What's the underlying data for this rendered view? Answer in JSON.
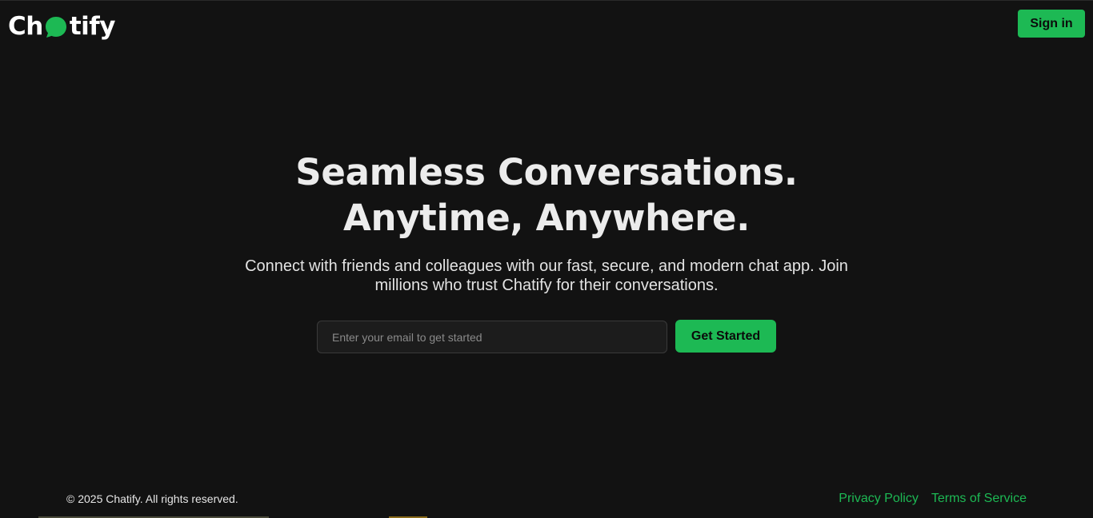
{
  "header": {
    "logo": {
      "prefix": "Ch",
      "suffix": "tify",
      "bubble_icon": "chat-bubble-icon",
      "bubble_color": "#1db954"
    },
    "signin_label": "Sign in"
  },
  "hero": {
    "title_line1": "Seamless Conversations.",
    "title_line2": "Anytime, Anywhere.",
    "subtitle": "Connect with friends and colleagues with our fast, secure, and modern chat app. Join millions who trust Chatify for their conversations.",
    "email_placeholder": "Enter your email to get started",
    "email_value": "",
    "cta_label": "Get Started"
  },
  "footer": {
    "copyright": "© 2025 Chatify. All rights reserved.",
    "links": [
      {
        "label": "Privacy Policy"
      },
      {
        "label": "Terms of Service"
      }
    ]
  },
  "colors": {
    "background": "#121212",
    "accent": "#1db954",
    "text": "#ececec"
  }
}
